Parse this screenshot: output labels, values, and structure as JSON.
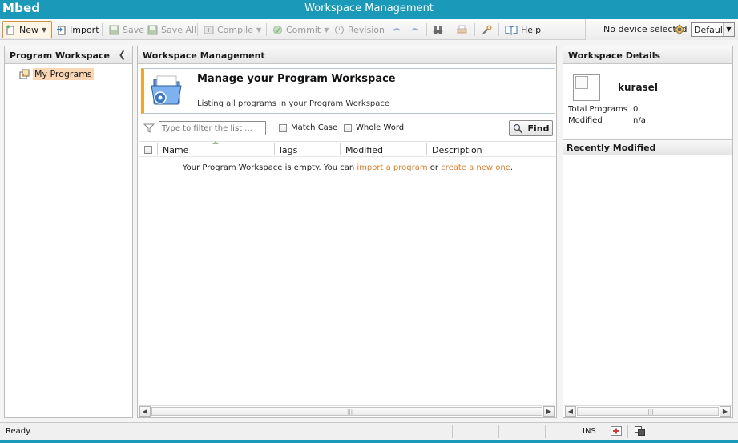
{
  "app": {
    "logo": "Mbed",
    "window_title": "Workspace Management"
  },
  "toolbar": {
    "new": "New",
    "import": "Import",
    "save": "Save",
    "save_all": "Save All",
    "compile": "Compile",
    "commit": "Commit",
    "revision": "Revision",
    "help": "Help"
  },
  "device": {
    "status": "No device selected",
    "profile": "Default"
  },
  "left_panel": {
    "title": "Program Workspace",
    "tree": [
      {
        "label": "My Programs",
        "selected": true
      }
    ]
  },
  "center_panel": {
    "title": "Workspace Management",
    "banner": {
      "heading": "Manage your Program Workspace",
      "description": "Listing all programs in your Program Workspace"
    },
    "filter": {
      "placeholder": "Type to filter the list ...",
      "match_case": "Match Case",
      "whole_word": "Whole Word",
      "find": "Find"
    },
    "columns": [
      "Name",
      "Tags",
      "Modified",
      "Description"
    ],
    "empty": {
      "before": "Your Program Workspace is empty. You can",
      "link1": "import a program",
      "middle": "or",
      "link2": "create a new one",
      "after": "."
    }
  },
  "right_panel": {
    "title": "Workspace Details",
    "username": "kurasel",
    "total_programs_label": "Total Programs",
    "total_programs": "0",
    "modified_label": "Modified",
    "modified": "n/a",
    "recent_title": "Recently Modified"
  },
  "status": {
    "message": "Ready.",
    "mode": "INS"
  },
  "colors": {
    "accent": "#1a9ab8",
    "link": "#d9812e",
    "highlight": "#f9d7b4"
  }
}
